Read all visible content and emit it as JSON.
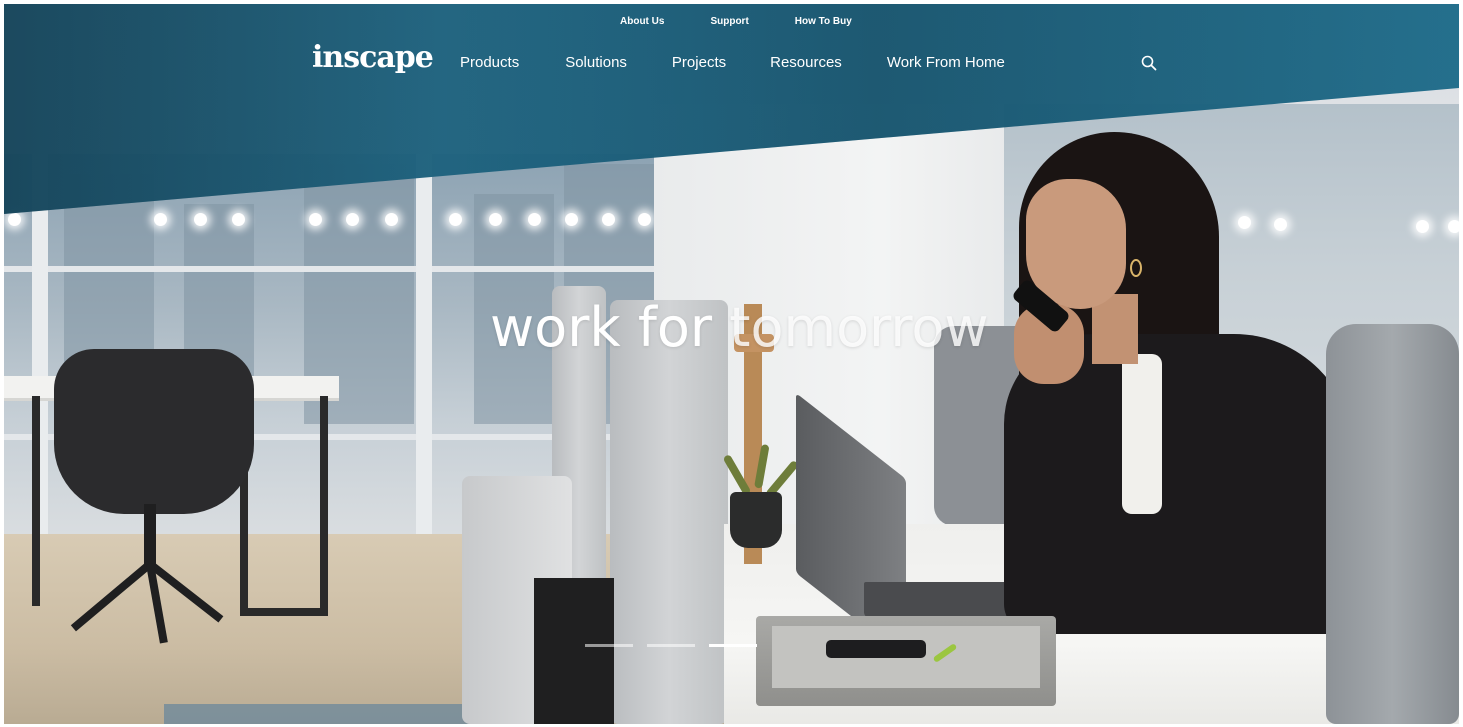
{
  "header": {
    "logo_text": "inscape",
    "utility_nav": [
      {
        "label": "About Us"
      },
      {
        "label": "Support"
      },
      {
        "label": "How To Buy"
      }
    ],
    "main_nav": [
      {
        "label": "Products"
      },
      {
        "label": "Solutions"
      },
      {
        "label": "Projects"
      },
      {
        "label": "Resources"
      },
      {
        "label": "Work From Home"
      }
    ],
    "search_icon": "search-icon"
  },
  "hero": {
    "headline_part1": "work for",
    "headline_part2": "tomorrow",
    "slides": {
      "count": 3,
      "active_index": 2
    }
  },
  "colors": {
    "header_teal": "#1e6582",
    "text_white": "#ffffff"
  }
}
